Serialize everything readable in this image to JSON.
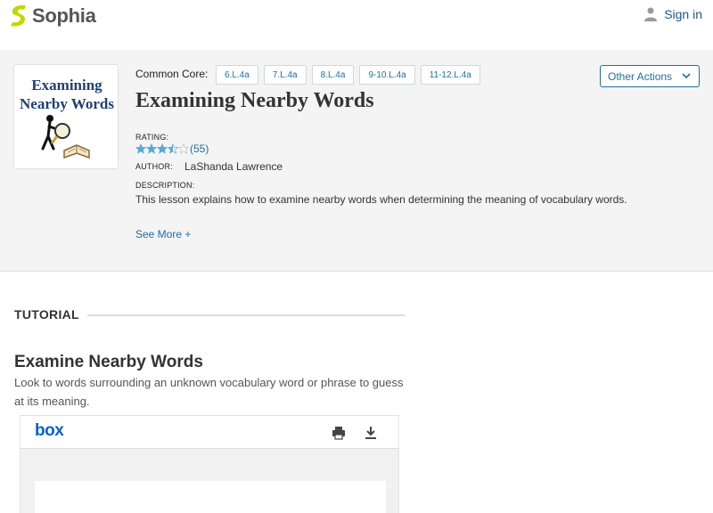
{
  "nav": {
    "logo_text": "Sophia",
    "signin_label": "Sign in"
  },
  "lesson": {
    "thumbnail_text": "Examining Nearby Words",
    "common_core_label": "Common Core:",
    "common_core_tags": [
      "6.L.4a",
      "7.L.4a",
      "8.L.4a",
      "9-10.L.4a",
      "11-12.L.4a"
    ],
    "other_actions_label": "Other Actions",
    "title": "Examining Nearby Words",
    "rating_label": "RATING:",
    "rating_value": 3.5,
    "rating_max": 5,
    "rating_count": "(55)",
    "author_label": "AUTHOR:",
    "author_name": "LaShanda Lawrence",
    "description_label": "DESCRIPTION:",
    "description": "This lesson explains how to examine nearby words when determining the meaning of vocabulary words.",
    "see_more_label": "See More +"
  },
  "tutorial": {
    "label": "TUTORIAL",
    "section_title": "Examine Nearby Words",
    "section_description": "Look to words surrounding an unknown vocabulary word or phrase to guess at its meaning."
  },
  "viewer": {
    "logo_text": "box"
  },
  "colors": {
    "accent": "#1f6ea6",
    "star": "#5aa9d6",
    "brand_green": "#c4d600",
    "box_blue": "#0061d5"
  }
}
